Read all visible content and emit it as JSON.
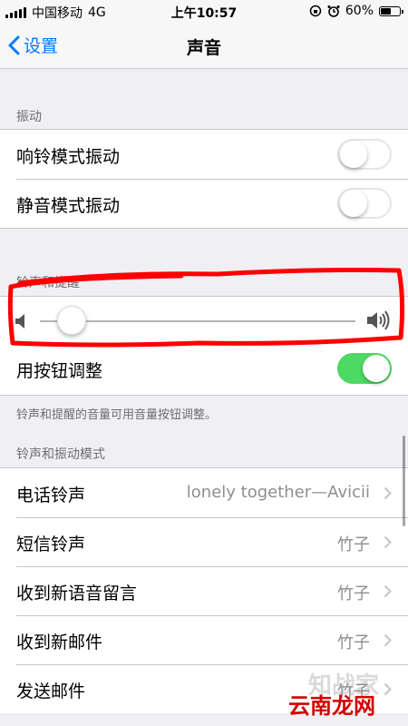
{
  "status_bar": {
    "carrier": "中国移动",
    "network": "4G",
    "time": "上午10:57",
    "battery_text": "60%",
    "battery_level": 0.6
  },
  "nav": {
    "back_label": "设置",
    "title": "声音"
  },
  "vibrate": {
    "header": "振动",
    "rows": [
      {
        "label": "响铃模式振动",
        "on": false
      },
      {
        "label": "静音模式振动",
        "on": false
      }
    ]
  },
  "ringer": {
    "header": "铃声和提醒",
    "volume_level": 0.1,
    "buttons_row": {
      "label": "用按钮调整",
      "on": true
    },
    "footer": "铃声和提醒的音量可用音量按钮调整。"
  },
  "patterns": {
    "header": "铃声和振动模式",
    "rows": [
      {
        "label": "电话铃声",
        "value": "lonely together—Avicii"
      },
      {
        "label": "短信铃声",
        "value": "竹子"
      },
      {
        "label": "收到新语音留言",
        "value": "竹子"
      },
      {
        "label": "收到新邮件",
        "value": "竹子"
      },
      {
        "label": "发送邮件",
        "value": "竹子"
      }
    ]
  },
  "colors": {
    "accent": "#007aff",
    "toggle_on": "#4cd964",
    "annotation": "#ff0000"
  },
  "watermark": {
    "brand_gray": "知战家",
    "brand_red": "云南龙网"
  }
}
